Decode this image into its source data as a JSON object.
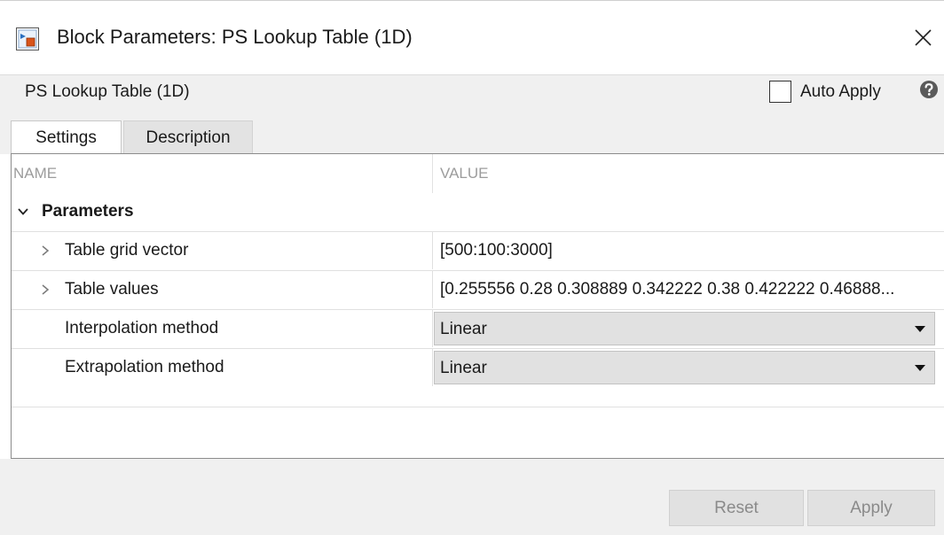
{
  "window": {
    "title": "Block Parameters: PS Lookup Table (1D)",
    "app_icon": "simulink-block-icon",
    "close_icon": "close-icon"
  },
  "header": {
    "block_name": "PS Lookup Table (1D)",
    "auto_apply": {
      "label": "Auto Apply",
      "checked": false
    },
    "help_icon": "help-icon"
  },
  "tabs": [
    {
      "label": "Settings",
      "active": true
    },
    {
      "label": "Description",
      "active": false
    }
  ],
  "table": {
    "columns": {
      "name": "NAME",
      "value": "VALUE"
    },
    "group": {
      "label": "Parameters",
      "expanded": true
    },
    "rows": [
      {
        "label": "Table grid vector",
        "value": "[500:100:3000]",
        "type": "text",
        "expandable": true
      },
      {
        "label": "Table values",
        "value": "[0.255556 0.28 0.308889 0.342222 0.38 0.422222 0.46888...",
        "type": "text",
        "expandable": true
      },
      {
        "label": "Interpolation method",
        "value": "Linear",
        "type": "dropdown",
        "expandable": false
      },
      {
        "label": "Extrapolation method",
        "value": "Linear",
        "type": "dropdown",
        "expandable": false
      }
    ]
  },
  "footer": {
    "reset_label": "Reset",
    "apply_label": "Apply"
  },
  "colors": {
    "chrome_bg": "#f0f0f0",
    "dropdown_bg": "#e1e1e1",
    "disabled_text": "#8a8a8a",
    "panel_border": "#8c8c8c"
  }
}
